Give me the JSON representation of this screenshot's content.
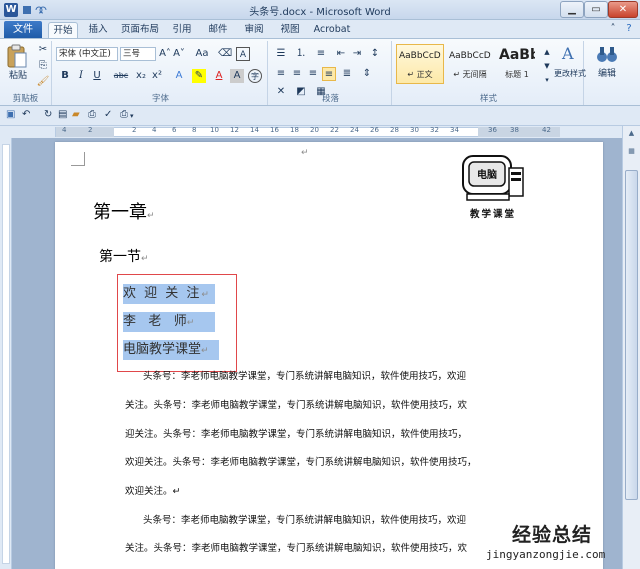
{
  "window": {
    "title": "头条号.docx - Microsoft Word",
    "app_icon": "W"
  },
  "ribbon_tabs": {
    "file": "文件",
    "tabs": [
      "开始",
      "插入",
      "页面布局",
      "引用",
      "邮件",
      "审阅",
      "视图",
      "Acrobat"
    ],
    "active": "开始"
  },
  "clipboard": {
    "paste_label": "粘贴",
    "group_label": "剪贴板"
  },
  "font": {
    "font_name": "宋体 (中文正)",
    "font_size": "三号",
    "grow": "A˄",
    "shrink": "A˅",
    "change_case": "Aa",
    "bold": "B",
    "italic": "I",
    "underline": "U",
    "strikethrough": "abc",
    "subscript": "x₂",
    "superscript": "x²",
    "group_label": "字体"
  },
  "paragraph": {
    "group_label": "段落"
  },
  "styles": {
    "items": [
      {
        "sample": "AaBbCcDd",
        "name": "↵ 正文"
      },
      {
        "sample": "AaBbCcDd",
        "name": "↵ 无间隔"
      },
      {
        "sample": "AaBb",
        "name": "标题 1"
      }
    ],
    "change_styles": "更改样式",
    "group_label": "样式"
  },
  "editing": {
    "label": "编辑"
  },
  "ruler": {
    "numbers": [
      "4",
      "2",
      "2",
      "4",
      "6",
      "8",
      "10",
      "12",
      "14",
      "16",
      "18",
      "20",
      "22",
      "24",
      "26",
      "28",
      "30",
      "32",
      "34",
      "36",
      "38",
      "42"
    ]
  },
  "document": {
    "logo_screen_text": "电脑",
    "logo_caption": "教学课堂",
    "chapter": "第一章",
    "section": "第一节",
    "selected_lines": [
      "欢 迎 关 注",
      "李   老   师",
      "电脑教学课堂"
    ],
    "paragraph_mark": "↵",
    "body_lines": [
      "头条号：李老师电脑教学课堂，专门系统讲解电脑知识，软件使用技巧，欢迎",
      "关注。头条号：李老师电脑教学课堂，专门系统讲解电脑知识，软件使用技巧，欢",
      "迎关注。头条号：李老师电脑教学课堂，专门系统讲解电脑知识，软件使用技巧，",
      "欢迎关注。头条号：李老师电脑教学课堂，专门系统讲解电脑知识，软件使用技巧，",
      "欢迎关注。↵",
      "头条号：李老师电脑教学课堂，专门系统讲解电脑知识，软件使用技巧，欢迎",
      "关注。头条号：李老师电脑教学课堂，专门系统讲解电脑知识，软件使用技巧，欢"
    ]
  },
  "watermark": {
    "big": "经验总结",
    "small": "jingyanzongjie.com"
  },
  "colors": {
    "selection": "#a6c7ef",
    "red_box": "#e0474a",
    "file_tab": "#2b6cbf"
  }
}
